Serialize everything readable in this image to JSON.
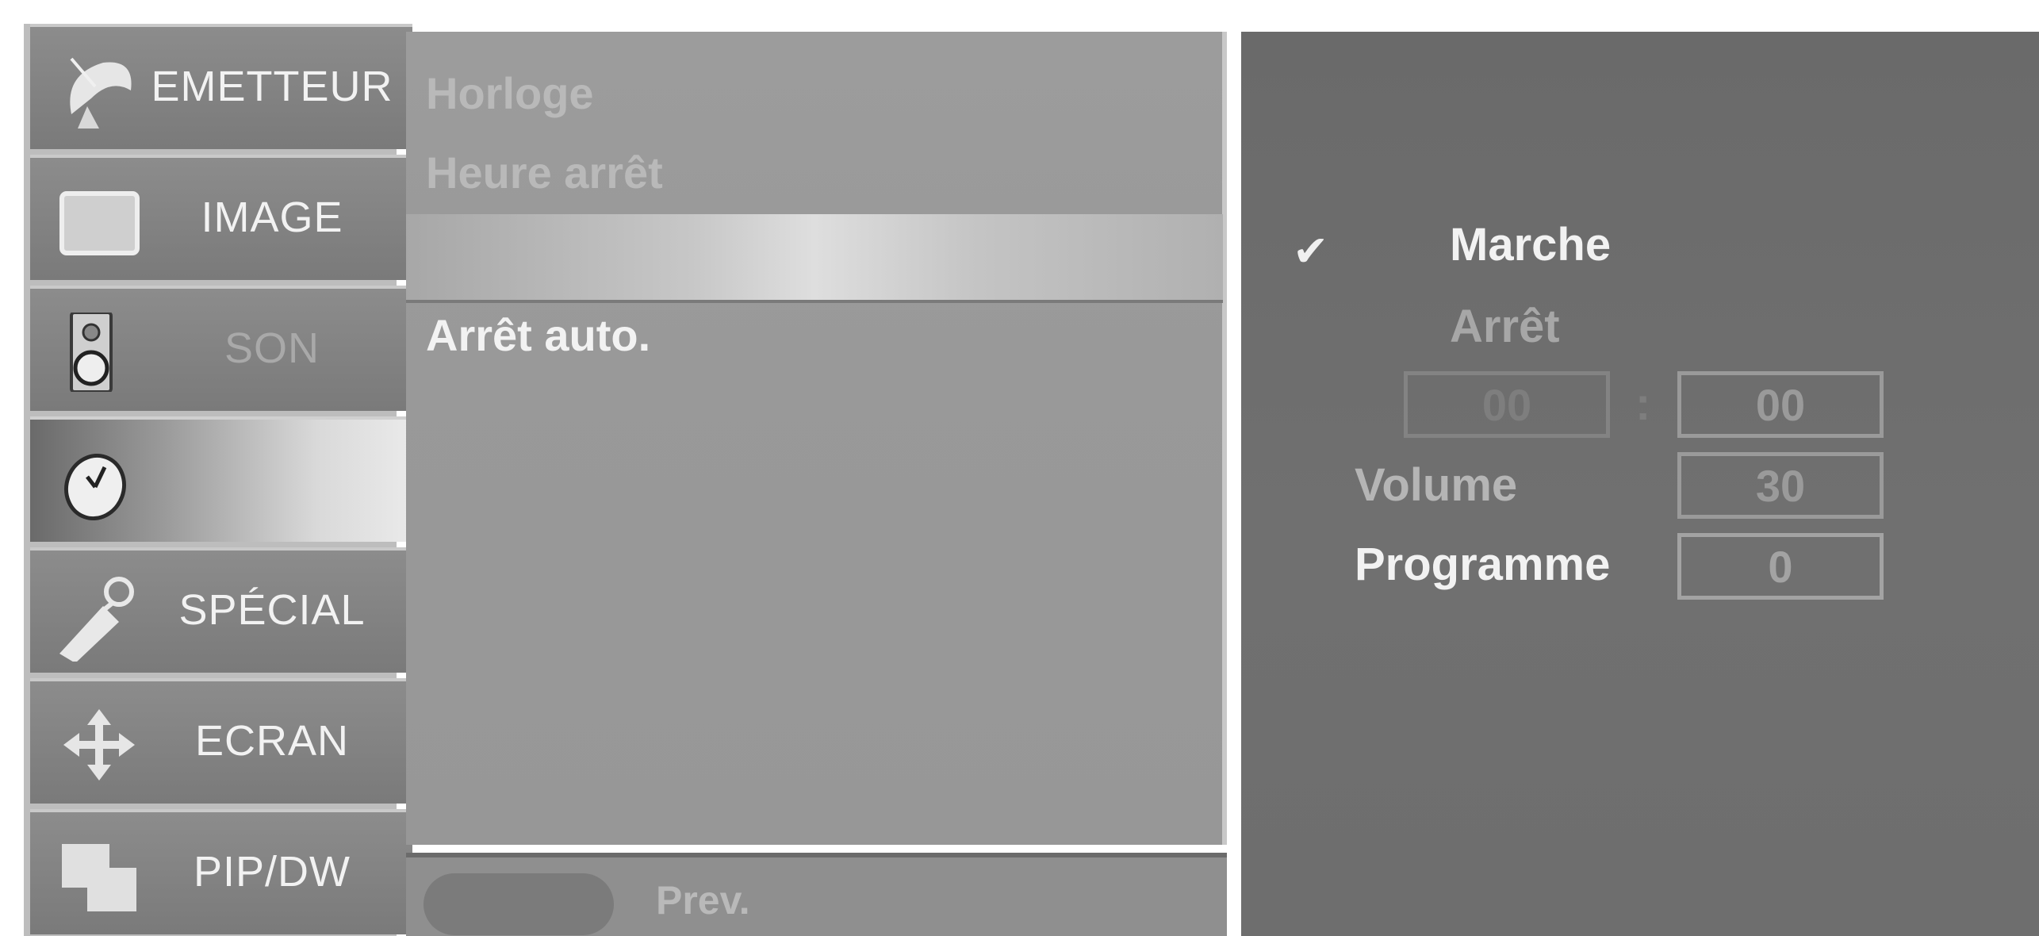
{
  "sidebar": {
    "categories": [
      {
        "label": "EMETTEUR",
        "icon": "satellite-dish-icon",
        "state": "normal"
      },
      {
        "label": "IMAGE",
        "icon": "tv-screen-icon",
        "state": "normal"
      },
      {
        "label": "SON",
        "icon": "speaker-icon",
        "state": "dim"
      },
      {
        "label": "",
        "icon": "clock-icon",
        "state": "selected"
      },
      {
        "label": "SPÉCIAL",
        "icon": "tag-icon",
        "state": "normal"
      },
      {
        "label": "ECRAN",
        "icon": "move-arrows-icon",
        "state": "normal"
      },
      {
        "label": "PIP/DW",
        "icon": "pip-windows-icon",
        "state": "normal"
      }
    ]
  },
  "submenu": {
    "items": [
      {
        "label": "Horloge"
      },
      {
        "label": "Heure arrêt"
      },
      {
        "label": ""
      },
      {
        "label": "Arrêt auto."
      }
    ]
  },
  "footer": {
    "prev_label": "Prev."
  },
  "options": {
    "on_label": "Marche",
    "off_label": "Arrêt",
    "checkmark": "✔",
    "time": {
      "hours": "00",
      "separator": ":",
      "minutes": "00"
    },
    "volume_label": "Volume",
    "volume_value": "30",
    "programme_label": "Programme",
    "programme_value": "0"
  },
  "colors": {
    "panel_dark": "#6e6e6e",
    "panel_mid": "#999999",
    "sidebar_item": "#828282",
    "text_bright": "#f2f2f2",
    "text_dim": "#b9b9b9"
  }
}
